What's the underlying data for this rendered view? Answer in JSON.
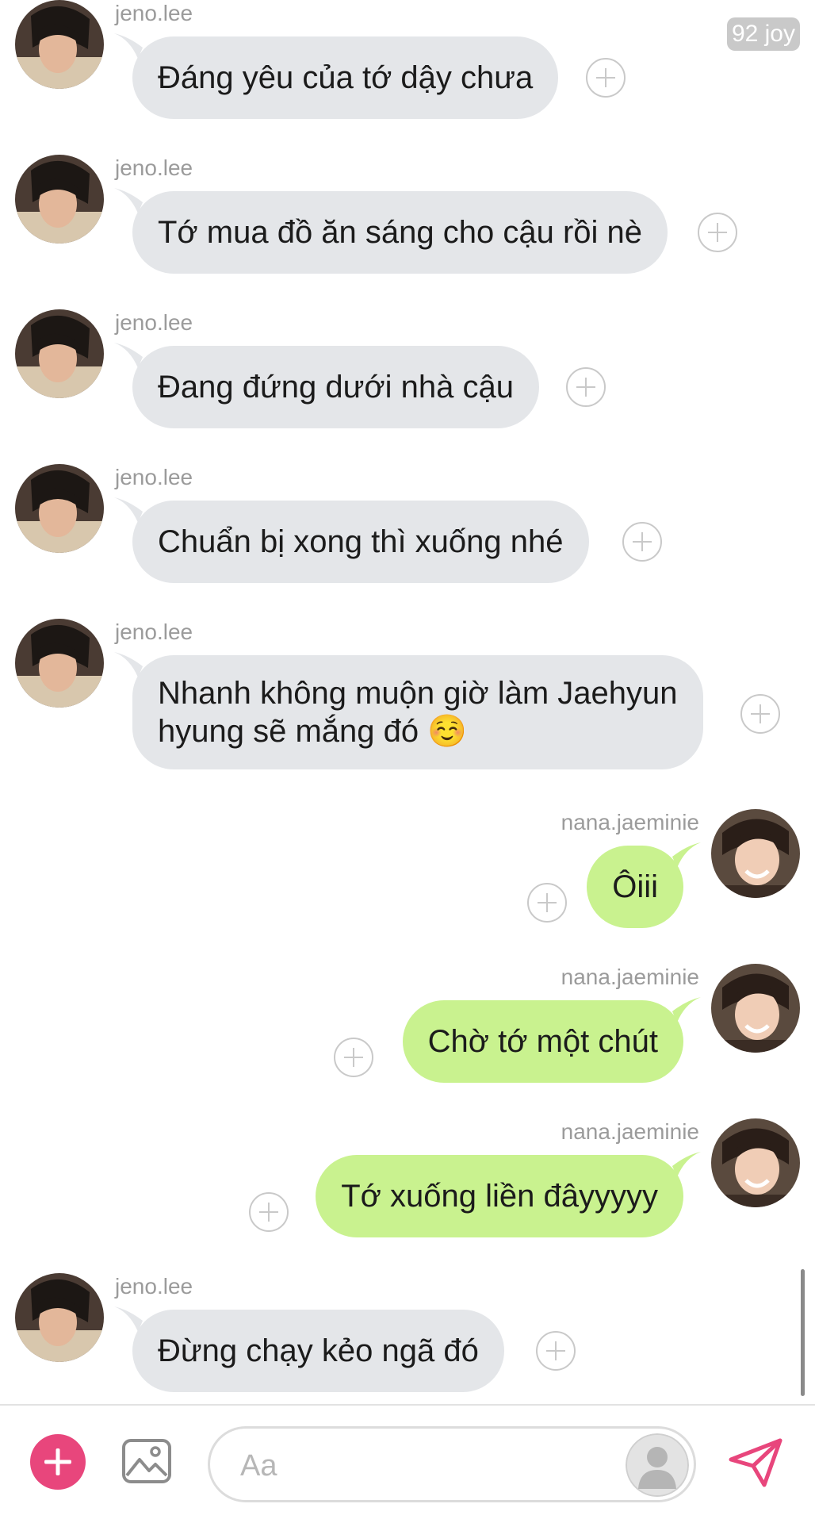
{
  "header": {
    "badge": "92 joy"
  },
  "colors": {
    "incoming_bubble": "#e4e6e9",
    "outgoing_bubble": "#c9f28f",
    "accent_pink": "#e8467c",
    "muted_text": "#9b9b9b"
  },
  "icons": {
    "add": "plus-icon",
    "react": "add-reaction-plus-icon",
    "gallery": "image-icon",
    "send": "paper-plane-icon",
    "avatar_placeholder": "user-silhouette-icon"
  },
  "messages": [
    {
      "sender": "jeno.lee",
      "side": "left",
      "text": "Đáng yêu của tớ dậy chưa"
    },
    {
      "sender": "jeno.lee",
      "side": "left",
      "text": "Tớ mua đồ ăn sáng cho cậu rồi nè"
    },
    {
      "sender": "jeno.lee",
      "side": "left",
      "text": "Đang đứng dưới nhà cậu"
    },
    {
      "sender": "jeno.lee",
      "side": "left",
      "text": "Chuẩn bị xong thì xuống nhé"
    },
    {
      "sender": "jeno.lee",
      "side": "left",
      "text": "Nhanh không muộn giờ làm Jaehyun\nhyung sẽ mắng đó ☺️"
    },
    {
      "sender": "nana.jaeminie",
      "side": "right",
      "text": "Ôiii"
    },
    {
      "sender": "nana.jaeminie",
      "side": "right",
      "text": "Chờ tớ một chút"
    },
    {
      "sender": "nana.jaeminie",
      "side": "right",
      "text": "Tớ xuống liền đâyyyyy"
    },
    {
      "sender": "jeno.lee",
      "side": "left",
      "text": "Đừng chạy kẻo ngã đó"
    }
  ],
  "composer": {
    "placeholder": "Aa",
    "value": ""
  }
}
